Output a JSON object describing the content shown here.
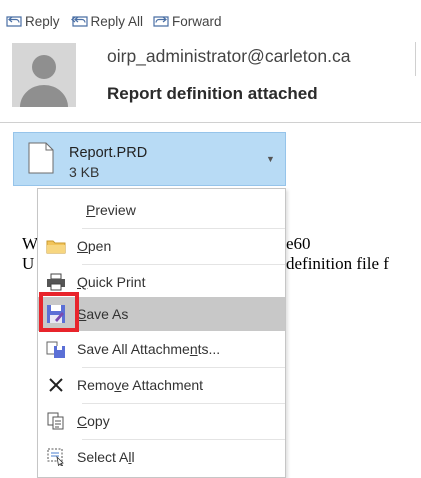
{
  "toolbar": {
    "reply_label": "Reply",
    "reply_all_label": "Reply All",
    "forward_label": "Forward"
  },
  "header": {
    "sender": "oirp_administrator@carleton.ca",
    "subject": "Report definition attached"
  },
  "attachment": {
    "name": "Report.PRD",
    "size": "3 KB"
  },
  "body": {
    "line1_start": "W",
    "line1_end": "e60",
    "line2_start": "U",
    "line2_end": "definition file f"
  },
  "menu": {
    "items": [
      {
        "label": "Preview",
        "icon": "none"
      },
      {
        "label": "Open",
        "icon": "folder-icon"
      },
      {
        "label": "Quick Print",
        "icon": "printer-icon"
      },
      {
        "label": "Save As",
        "icon": "save-as-icon",
        "highlighted": true
      },
      {
        "label": "Save All Attachments...",
        "icon": "save-all-icon"
      },
      {
        "label": "Remove Attachment",
        "icon": "remove-icon"
      },
      {
        "label": "Copy",
        "icon": "copy-icon"
      },
      {
        "label": "Select All",
        "icon": "select-all-icon"
      }
    ]
  },
  "colors": {
    "attachment_bg": "#b8dbf5",
    "highlight": "#c8c8c8",
    "annotation": "#e8242b"
  }
}
